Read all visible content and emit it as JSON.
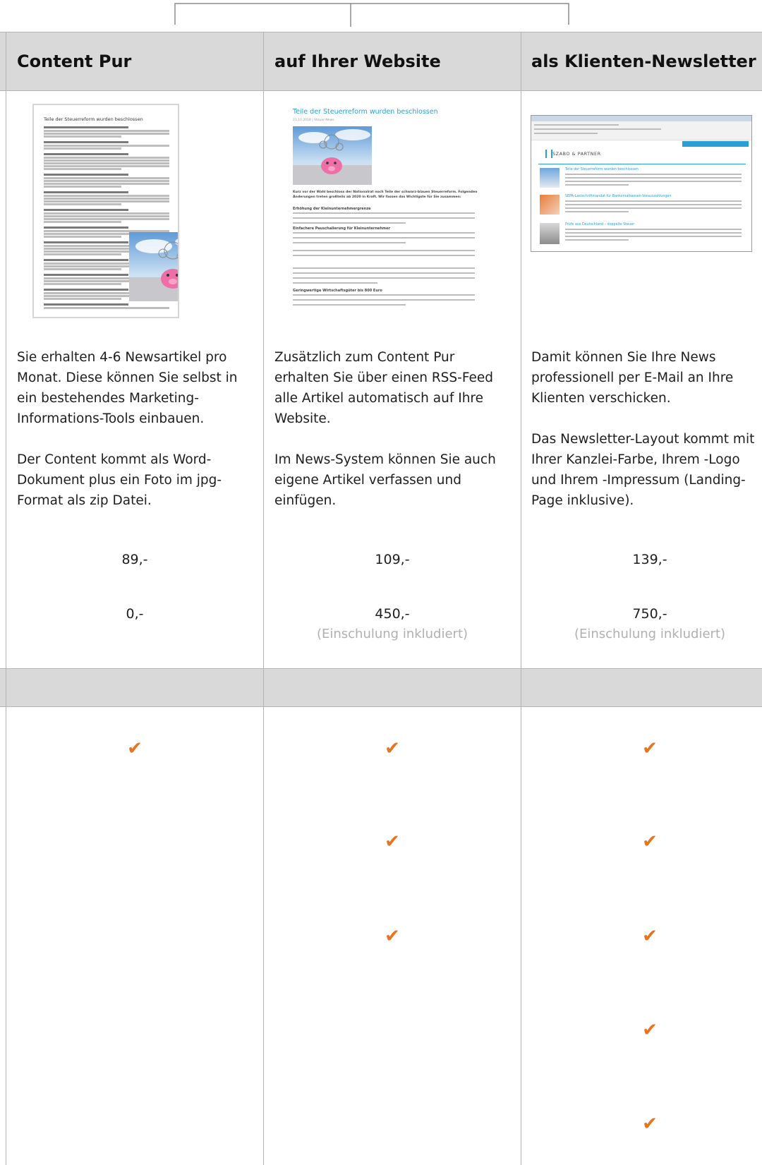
{
  "columns": [
    {
      "title": "Content Pur",
      "description": [
        "Sie erhalten 4-6 Newsartikel pro Monat. Diese können Sie selbst in ein bestehendes Marketing-Informations-Tools einbauen.",
        "Der Content kommt als Word-Dokument plus ein Foto im jpg-Format als zip Datei."
      ],
      "price_monthly": "89,-",
      "price_setup": "0,-",
      "price_setup_note": "",
      "checks": [
        true,
        false,
        false,
        false,
        false
      ],
      "thumbnail": {
        "kind": "word-document",
        "heading": "Teile der Steuerreform wurden beschlossen"
      }
    },
    {
      "title": "auf Ihrer Website",
      "description": [
        "Zusätzlich zum Content Pur erhalten Sie über einen RSS-Feed alle Artikel automatisch auf Ihre Website.",
        "Im News-System können Sie auch eigene Artikel verfassen und einfügen."
      ],
      "price_monthly": "109,-",
      "price_setup": "450,-",
      "price_setup_note": "(Einschulung inkludiert)",
      "checks": [
        true,
        true,
        true,
        false,
        false
      ],
      "thumbnail": {
        "kind": "website-article",
        "heading": "Teile der Steuerreform wurden beschlossen",
        "meta": "23.10.2018 | Steuer-News",
        "lead": "Kurz vor der Wahl beschloss der Nationalrat noch Teile der schwarz-blauen Steuerreform. Folgenden Änderungen treten großteils ab 2020 in Kraft. Wir fassen das Wichtigste für Sie zusammen:",
        "sections": [
          "Erhöhung der Kleinunternehmergrenze",
          "Einfachere Pauschalierung für Kleinunternehmer",
          "Geringwertige Wirtschaftsgüter bis 800 Euro"
        ]
      }
    },
    {
      "title": "als Klienten-Newsletter",
      "description": [
        "Damit können Sie Ihre News professionell per E-Mail an Ihre Klienten verschicken.",
        "Das Newsletter-Layout kommt mit Ihrer Kanzlei-Farbe, Ihrem -Logo und Ihrem -Impressum (Landing-Page inklusive)."
      ],
      "price_monthly": "139,-",
      "price_setup": "750,-",
      "price_setup_note": "(Einschulung inkludiert)",
      "checks": [
        true,
        true,
        true,
        true,
        true
      ],
      "thumbnail": {
        "kind": "email-newsletter",
        "brand": "SZABO & PARTNER",
        "items": [
          "Teile der Steuerreform wurden beschlossen",
          "SEPA-Lastschriftmandat für Bankomatkassen-Vorauszahlungen",
          "Prüfe aus Deutschland – doppelte Steuer"
        ]
      }
    }
  ],
  "colors": {
    "header_background": "#d9d9d9",
    "grid_line": "#b4b4b4",
    "checkmark": "#e8741e",
    "note_text": "#b0b0b0",
    "accent_link": "#2a9fd6"
  },
  "icons": {
    "check": "✔"
  }
}
